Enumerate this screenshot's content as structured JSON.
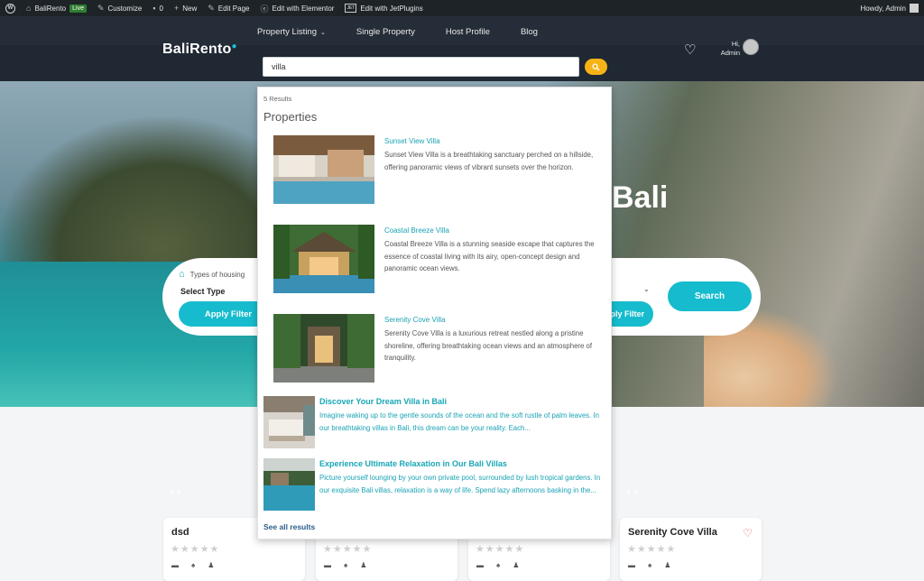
{
  "adminbar": {
    "site": "BaliRento",
    "live": "Live",
    "customize": "Customize",
    "comments": "0",
    "new": "New",
    "edit_page": "Edit Page",
    "elementor": "Edit with Elementor",
    "jet": "Edit with JetPlugins",
    "jet_badge": "JET",
    "howdy": "Howdy, Admin"
  },
  "header": {
    "logo": "BaliRento",
    "nav": [
      "Property Listing",
      "Single Property",
      "Host Profile",
      "Blog"
    ],
    "user_hi": "Hi,",
    "user_name": "Admin"
  },
  "search": {
    "value": "villa"
  },
  "hero": {
    "title": "Bali"
  },
  "filter": {
    "types_label": "Types of housing",
    "select_type": "Select Type",
    "apply_left": "Apply Filter",
    "apply_right": "ply Filter",
    "search_btn": "Search"
  },
  "cards": [
    {
      "title": "dsd"
    },
    {
      "title": ""
    },
    {
      "title": ""
    },
    {
      "title": "Serenity Cove Villa"
    }
  ],
  "dropdown": {
    "count": "5 Results",
    "heading": "Properties",
    "properties": [
      {
        "title": "Sunset View Villa",
        "desc": "Sunset View Villa is a breathtaking sanctuary perched on a hillside, offering panoramic views of vibrant sunsets over the horizon."
      },
      {
        "title": "Coastal Breeze Villa",
        "desc": "Coastal Breeze Villa is a stunning seaside escape that captures the essence of coastal living with its airy, open-concept design and panoramic ocean views."
      },
      {
        "title": "Serenity Cove Villa",
        "desc": "Serenity Cove Villa is a luxurious retreat nestled along a pristine shoreline, offering breathtaking ocean views and an atmosphere of tranquility."
      }
    ],
    "posts": [
      {
        "title": "Discover Your Dream Villa in Bali",
        "desc": "Imagine waking up to the gentle sounds of the ocean and the soft rustle of palm leaves. In our breathtaking villas in Bali, this dream can be your reality. Each..."
      },
      {
        "title": "Experience Ultimate Relaxation in Our Bali Villas",
        "desc": "Picture yourself lounging by your own private pool, surrounded by lush tropical gardens. In our exquisite Bali villas, relaxation is a way of life. Spend lazy afternoons basking in the..."
      }
    ],
    "see_all": "See all results"
  }
}
